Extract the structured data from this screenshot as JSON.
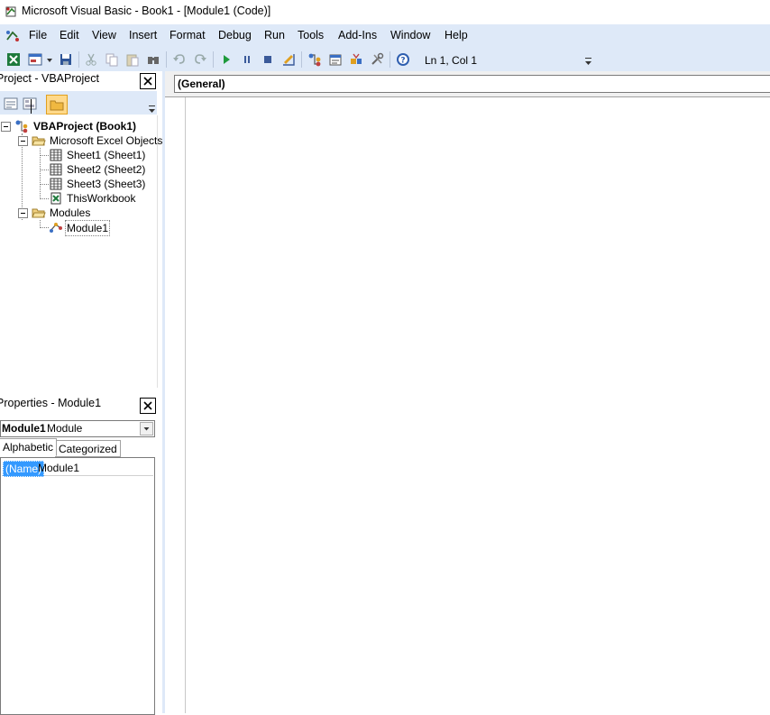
{
  "window": {
    "title": "Microsoft Visual Basic - Book1 - [Module1 (Code)]"
  },
  "menu": {
    "items": [
      "File",
      "Edit",
      "View",
      "Insert",
      "Format",
      "Debug",
      "Run",
      "Tools",
      "Add-Ins",
      "Window",
      "Help"
    ]
  },
  "toolbar": {
    "buttons": [
      "view-excel-icon",
      "insert-userform-icon",
      "dropdown-arrow-icon",
      "save-icon",
      "cut-icon",
      "copy-icon",
      "paste-icon",
      "find-icon",
      "undo-icon",
      "redo-icon",
      "run-icon",
      "break-icon",
      "reset-icon",
      "design-mode-icon",
      "project-explorer-icon",
      "properties-window-icon",
      "object-browser-icon",
      "toolbox-icon",
      "help-icon"
    ],
    "position_readout": "Ln 1, Col 1"
  },
  "project_pane": {
    "title": "Project - VBAProject",
    "tree": {
      "root": "VBAProject (Book1)",
      "excel_objects_folder": "Microsoft Excel Objects",
      "sheet1": "Sheet1 (Sheet1)",
      "sheet2": "Sheet2 (Sheet2)",
      "sheet3": "Sheet3 (Sheet3)",
      "thisworkbook": "ThisWorkbook",
      "modules_folder": "Modules",
      "module1": "Module1"
    }
  },
  "properties_pane": {
    "title": "Properties - Module1",
    "object_name": "Module1",
    "object_type": "Module",
    "tabs": [
      "Alphabetic",
      "Categorized"
    ],
    "rows": [
      {
        "name": "(Name)",
        "value": "Module1"
      }
    ]
  },
  "code_window": {
    "object_selector": "(General)"
  },
  "colors": {
    "chrome": "#dee9f8",
    "selection": "#3399ff"
  }
}
